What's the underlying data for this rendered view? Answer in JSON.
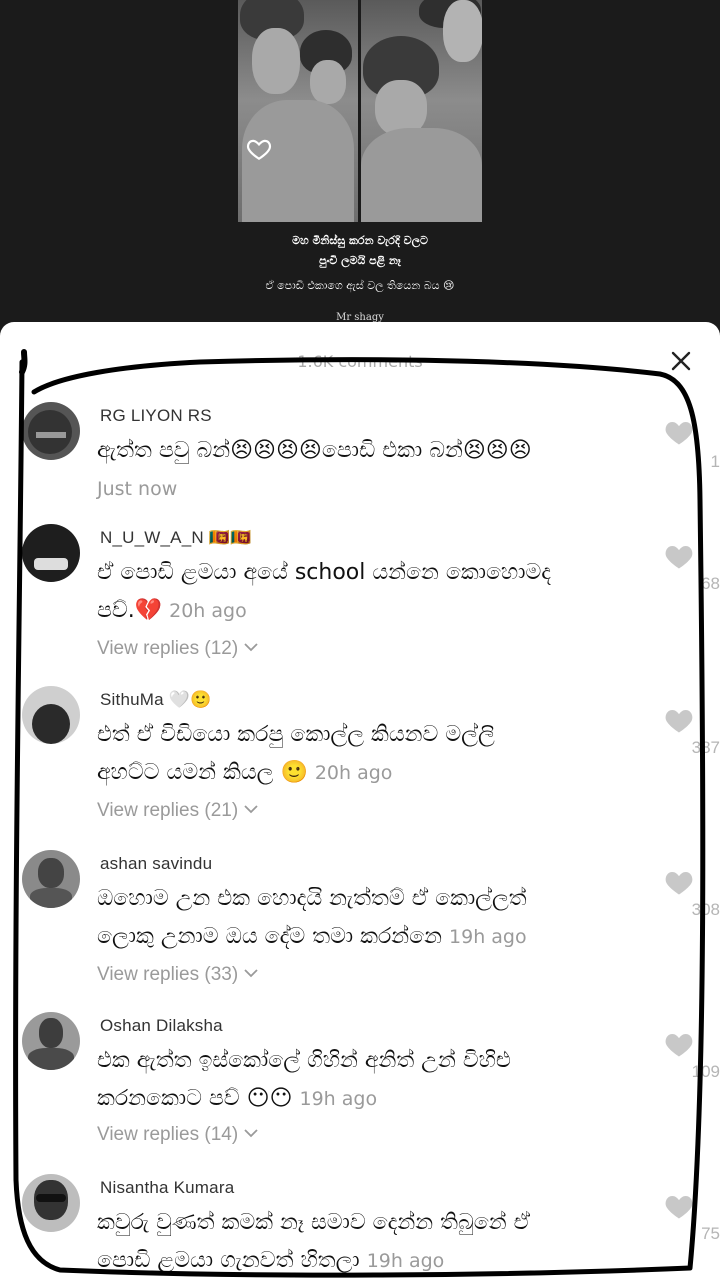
{
  "video": {
    "caption_line1": "මහ මිනිස්සු කරන වැරදි වලට",
    "caption_line2": "පුංචි ලමයි පළි නෑ",
    "caption_line3": "ඒ පොඩි එකාගෙ ඇස් වල තියෙන බය 😢",
    "watermark": "Mr shagy"
  },
  "sheet": {
    "header": "1.6K comments"
  },
  "comments": [
    {
      "username": "RG LIYON RS",
      "text_line1": "ඇත්ත පවු බන්😣😣😣😣පොඩි එකා බන්😣😣😣",
      "time": "Just now",
      "likes": "1"
    },
    {
      "username": "N_U_W_A_N 🇱🇰🇱🇰",
      "text_line1": "ඒ පොඩි ළමයා අයේ school යන්නෙ කොහොමද",
      "text_line2": "පව්.💔",
      "time": "20h ago",
      "replies": "View replies (12)",
      "likes": "68"
    },
    {
      "username": "SithuMa 🤍🙂",
      "text_line1": "එත් ඒ විඩියො කරපු කොල්ල කියනව මල්ලි",
      "text_line2": "අහට්ට යමන් කියල 🙂",
      "time": "20h ago",
      "replies": "View replies (21)",
      "likes": "387"
    },
    {
      "username": "ashan savindu",
      "text_line1": "ඔහොම උන එක හොදයි නැත්තම් ඒ කොල්ලත්",
      "text_line2": "ලොකු උනාම ඔය දේම තමා කරන්නෙ",
      "time": "19h ago",
      "replies": "View replies (33)",
      "likes": "308"
    },
    {
      "username": "Oshan Dilaksha",
      "text_line1": "එක ඇත්ත ඉස්කෝලේ ගිහින් අනිත් උන් විහිළු",
      "text_line2": "කරනකොට පව් 😶😶",
      "time": "19h ago",
      "replies": "View replies (14)",
      "likes": "109"
    },
    {
      "username": "Nisantha Kumara",
      "text_line1": "කවුරු වුණත් කමක් නෑ සමාව දෙන්න තිබුනේ ඒ",
      "text_line2": "පොඩි ළමයා ගැනවත් හිතලා",
      "time": "19h ago",
      "likes": "75"
    }
  ],
  "colors": {
    "sheet_bg": "#ffffff",
    "video_bg": "#1b1b1b",
    "muted_text": "#9a9a9a",
    "like_icon": "#c8c8c8"
  }
}
